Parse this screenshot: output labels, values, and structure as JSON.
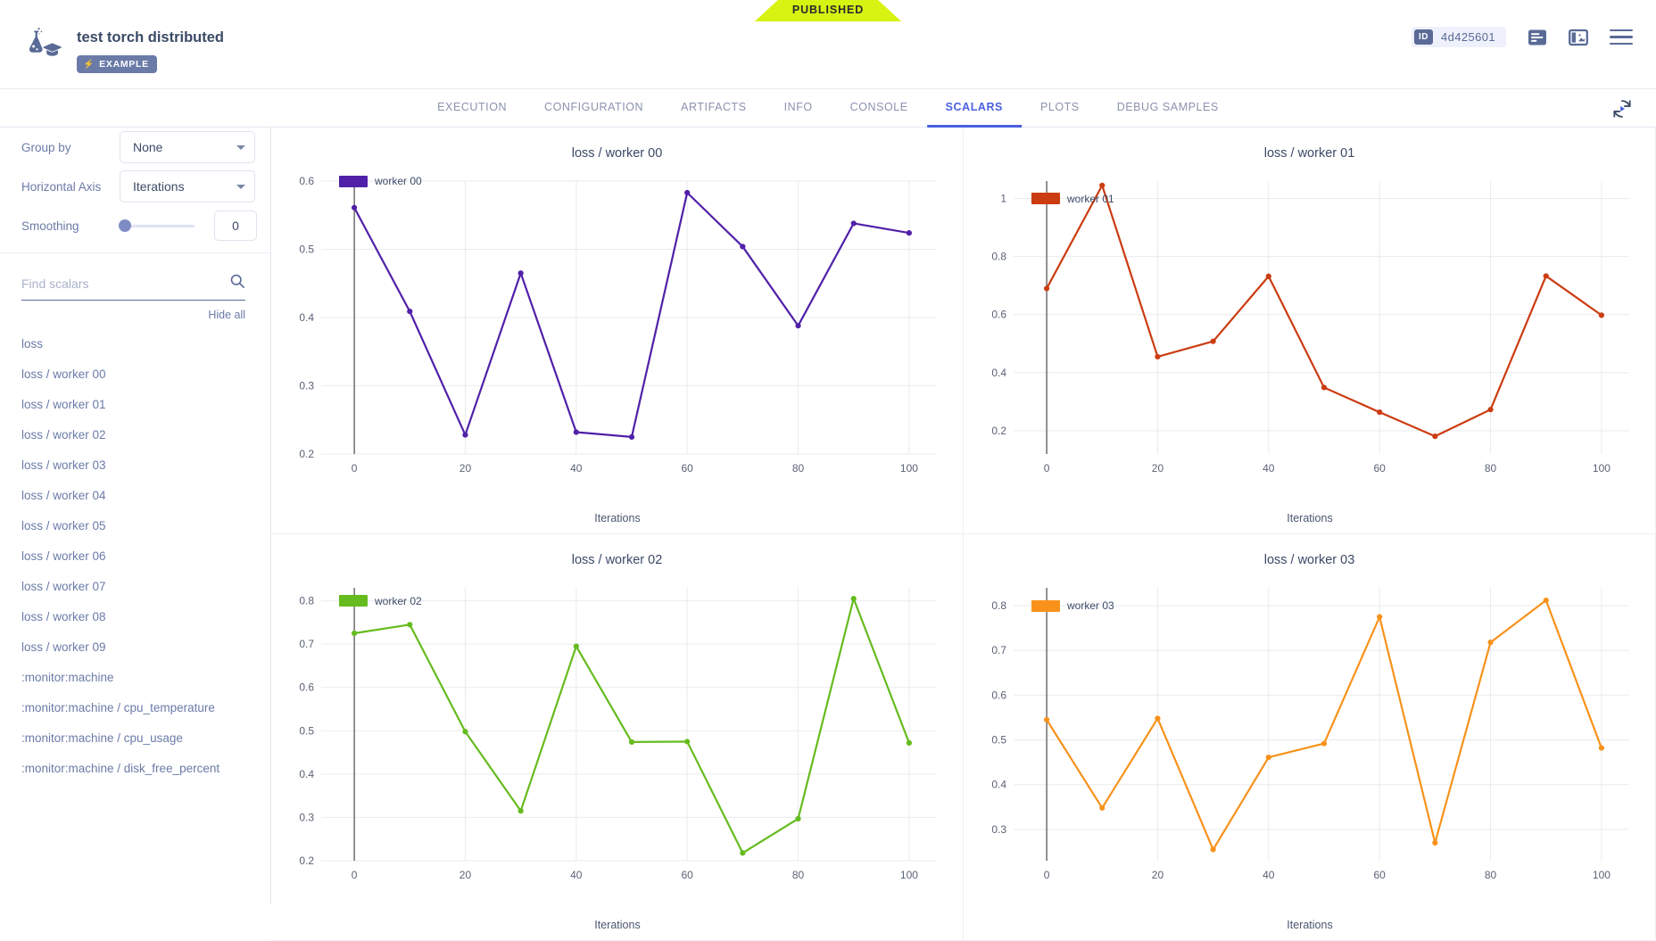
{
  "banner": {
    "published_label": "PUBLISHED",
    "color": "#d6f312"
  },
  "header": {
    "task_title": "test torch distributed",
    "example_badge": "EXAMPLE",
    "id_tag_label": "ID",
    "id_value": "4d425601",
    "icons": [
      "log-icon",
      "panel-layout-icon",
      "hamburger-menu-icon"
    ]
  },
  "tabs": [
    {
      "label": "EXECUTION",
      "active": false
    },
    {
      "label": "CONFIGURATION",
      "active": false
    },
    {
      "label": "ARTIFACTS",
      "active": false
    },
    {
      "label": "INFO",
      "active": false
    },
    {
      "label": "CONSOLE",
      "active": false
    },
    {
      "label": "SCALARS",
      "active": true
    },
    {
      "label": "PLOTS",
      "active": false
    },
    {
      "label": "DEBUG SAMPLES",
      "active": false
    }
  ],
  "sidebar": {
    "group_by_label": "Group by",
    "group_by_value": "None",
    "horizontal_axis_label": "Horizontal Axis",
    "horizontal_axis_value": "Iterations",
    "smoothing_label": "Smoothing",
    "smoothing_value": "0",
    "search_placeholder": "Find scalars",
    "hide_all_label": "Hide all",
    "scalars": [
      "loss",
      "loss / worker 00",
      "loss / worker 01",
      "loss / worker 02",
      "loss / worker 03",
      "loss / worker 04",
      "loss / worker 05",
      "loss / worker 06",
      "loss / worker 07",
      "loss / worker 08",
      "loss / worker 09",
      ":monitor:machine",
      ":monitor:machine / cpu_temperature",
      ":monitor:machine / cpu_usage",
      ":monitor:machine / disk_free_percent"
    ]
  },
  "chart_data": [
    {
      "type": "line",
      "title": "loss / worker 00",
      "xlabel": "Iterations",
      "ylabel": "",
      "legend": "worker 00",
      "color": "#5120a8",
      "x": [
        0,
        10,
        20,
        30,
        40,
        50,
        60,
        70,
        80,
        90,
        100
      ],
      "values": [
        0.561,
        0.409,
        0.228,
        0.465,
        0.232,
        0.225,
        0.583,
        0.504,
        0.388,
        0.538,
        0.524
      ],
      "xlim": [
        -5,
        105
      ],
      "ylim": [
        0.2,
        0.6
      ],
      "xticks": [
        0,
        20,
        40,
        60,
        80,
        100
      ],
      "yticks": [
        0.2,
        0.3,
        0.4,
        0.5,
        0.6
      ],
      "ytick_labels": [
        "0.2",
        "0.3",
        "0.4",
        "0.5",
        "0.6"
      ],
      "grid": true,
      "legend_position": "top-left"
    },
    {
      "type": "line",
      "title": "loss / worker 01",
      "xlabel": "Iterations",
      "ylabel": "",
      "legend": "worker 01",
      "color": "#cb3c11",
      "x": [
        0,
        10,
        20,
        30,
        40,
        50,
        60,
        70,
        80,
        90,
        100
      ],
      "values": [
        0.69,
        1.045,
        0.455,
        0.508,
        0.732,
        0.349,
        0.264,
        0.181,
        0.273,
        0.733,
        0.598
      ],
      "xlim": [
        -5,
        105
      ],
      "ylim": [
        0.12,
        1.06
      ],
      "xticks": [
        0,
        20,
        40,
        60,
        80,
        100
      ],
      "yticks": [
        0.2,
        0.4,
        0.6,
        0.8,
        1.0
      ],
      "ytick_labels": [
        "0.2",
        "0.4",
        "0.6",
        "0.8",
        "1"
      ],
      "grid": true,
      "legend_position": "top-left"
    },
    {
      "type": "line",
      "title": "loss / worker 02",
      "xlabel": "Iterations",
      "ylabel": "",
      "legend": "worker 02",
      "color": "#66bb1e",
      "x": [
        0,
        10,
        20,
        30,
        40,
        50,
        60,
        70,
        80,
        90,
        100
      ],
      "values": [
        0.725,
        0.745,
        0.498,
        0.315,
        0.695,
        0.474,
        0.475,
        0.218,
        0.297,
        0.805,
        0.472
      ],
      "xlim": [
        -5,
        105
      ],
      "ylim": [
        0.2,
        0.83
      ],
      "xticks": [
        0,
        20,
        40,
        60,
        80,
        100
      ],
      "yticks": [
        0.2,
        0.3,
        0.4,
        0.5,
        0.6,
        0.7,
        0.8
      ],
      "ytick_labels": [
        "0.2",
        "0.3",
        "0.4",
        "0.5",
        "0.6",
        "0.7",
        "0.8"
      ],
      "grid": true,
      "legend_position": "top-left"
    },
    {
      "type": "line",
      "title": "loss / worker 03",
      "xlabel": "Iterations",
      "ylabel": "",
      "legend": "worker 03",
      "color": "#f8921b",
      "x": [
        0,
        10,
        20,
        30,
        40,
        50,
        60,
        70,
        80,
        90,
        100
      ],
      "values": [
        0.545,
        0.348,
        0.548,
        0.255,
        0.461,
        0.492,
        0.775,
        0.27,
        0.718,
        0.812,
        0.482
      ],
      "xlim": [
        -5,
        105
      ],
      "ylim": [
        0.23,
        0.84
      ],
      "xticks": [
        0,
        20,
        40,
        60,
        80,
        100
      ],
      "yticks": [
        0.3,
        0.4,
        0.5,
        0.6,
        0.7,
        0.8
      ],
      "ytick_labels": [
        "0.3",
        "0.4",
        "0.5",
        "0.6",
        "0.7",
        "0.8"
      ],
      "grid": true,
      "legend_position": "top-left"
    }
  ]
}
